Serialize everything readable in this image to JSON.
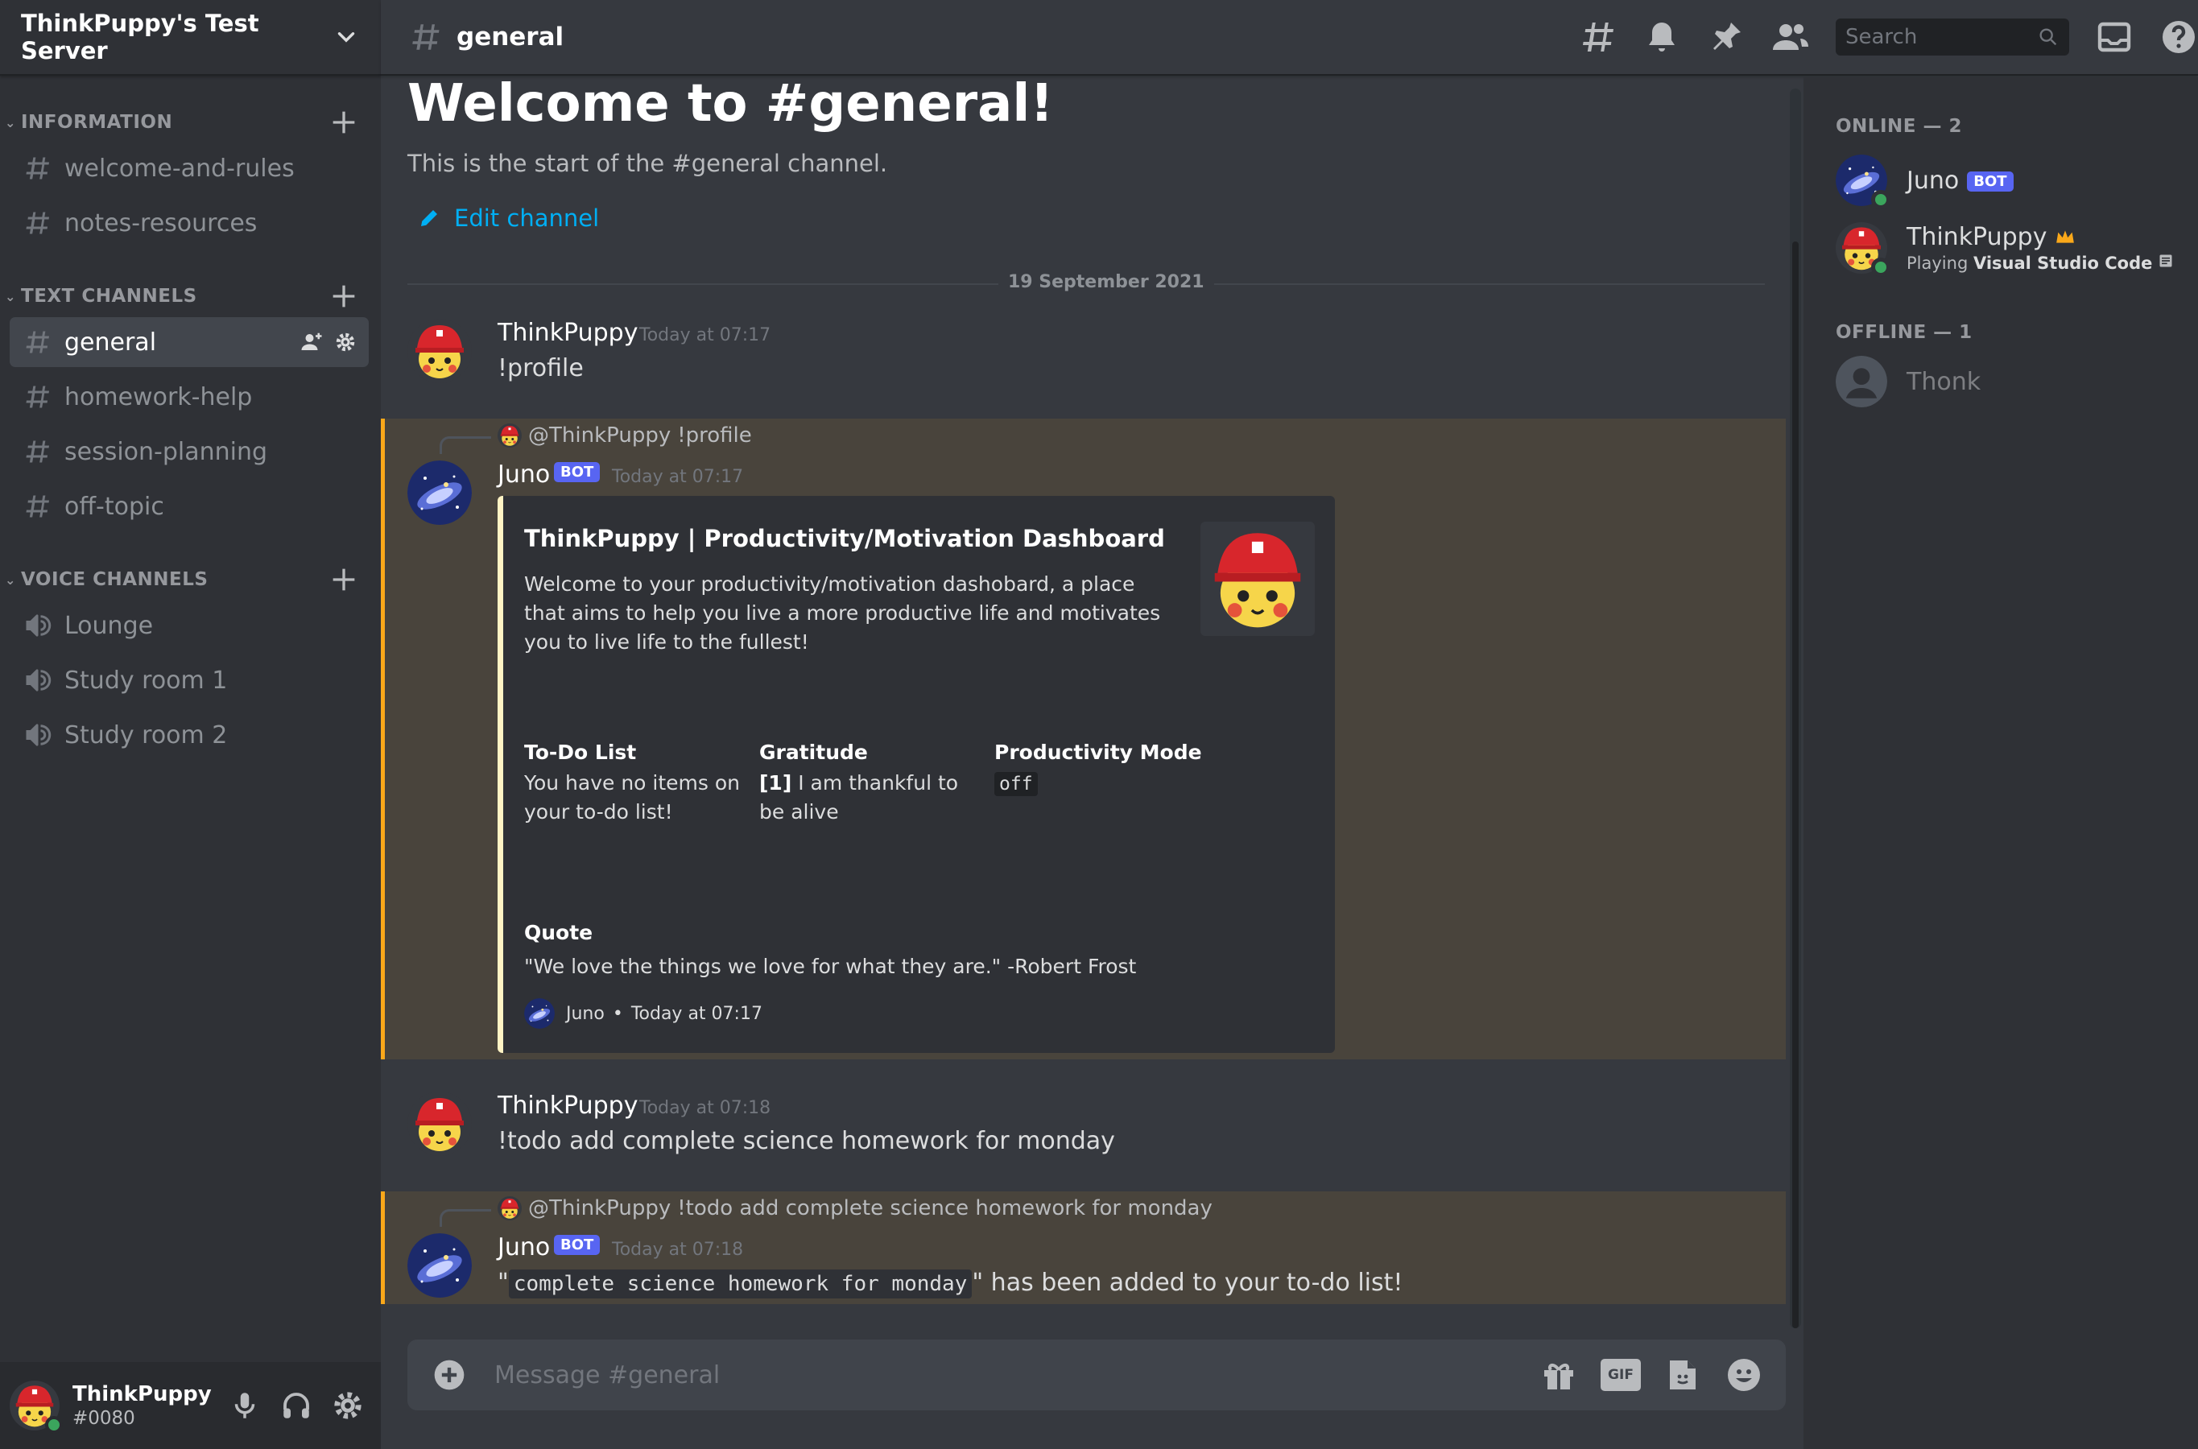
{
  "server": {
    "name": "ThinkPuppy's Test Server"
  },
  "categories": {
    "information": "INFORMATION",
    "text": "TEXT CHANNELS",
    "voice": "VOICE CHANNELS"
  },
  "info_channels": [
    "welcome-and-rules",
    "notes-resources"
  ],
  "text_channels": [
    "general",
    "homework-help",
    "session-planning",
    "off-topic"
  ],
  "voice_channels": [
    "Lounge",
    "Study room 1",
    "Study room 2"
  ],
  "user_panel": {
    "username": "ThinkPuppy",
    "tag": "#0080"
  },
  "topbar": {
    "channel": "general",
    "search_placeholder": "Search"
  },
  "welcome": {
    "title": "Welcome to #general!",
    "subtitle": "This is the start of the #general channel.",
    "edit": "Edit channel"
  },
  "date_divider": "19 September 2021",
  "messages": {
    "m1": {
      "author": "ThinkPuppy",
      "time": "Today at 07:17",
      "text": "!profile"
    },
    "m2": {
      "reply_mention": "@ThinkPuppy",
      "reply_text": "!profile",
      "author": "Juno",
      "bot": "BOT",
      "time": "Today at 07:17",
      "embed": {
        "title": "ThinkPuppy | Productivity/Motivation Dashboard",
        "description": "Welcome to your productivity/motivation dashobard, a place that aims to help you live a more productive life and motivates you to live life to the fullest!",
        "fields": {
          "todo_name": "To-Do List",
          "todo_value": "You have no items on your to-do list!",
          "grat_name": "Gratitude",
          "grat_index": "[1]",
          "grat_value": " I am thankful to be alive",
          "mode_name": "Productivity Mode",
          "mode_value": "off"
        },
        "quote_name": "Quote",
        "quote_value": "\"We love the things we love for what they are.\" -Robert Frost",
        "footer_author": "Juno",
        "footer_sep": "•",
        "footer_time": "Today at 07:17"
      }
    },
    "m3": {
      "author": "ThinkPuppy",
      "time": "Today at 07:18",
      "text": "!todo add complete science homework for monday"
    },
    "m4": {
      "reply_mention": "@ThinkPuppy",
      "reply_text": "!todo add complete science homework for monday",
      "author": "Juno",
      "bot": "BOT",
      "time": "Today at 07:18",
      "quote_open": "\"",
      "code": "complete science homework for monday",
      "text_after": "\" has been added to your to-do list!"
    }
  },
  "composer": {
    "placeholder": "Message #general",
    "gif": "GIF"
  },
  "members": {
    "online_header": "ONLINE — 2",
    "offline_header": "OFFLINE — 1",
    "juno": {
      "name": "Juno",
      "bot": "BOT"
    },
    "thinkpuppy": {
      "name": "ThinkPuppy",
      "activity_prefix": "Playing",
      "activity": "Visual Studio Code"
    },
    "thonk": {
      "name": "Thonk"
    }
  },
  "colors": {
    "accent": "#5865f2",
    "link": "#00aff4",
    "highlight": "#faa81a",
    "online": "#3ba55d"
  }
}
